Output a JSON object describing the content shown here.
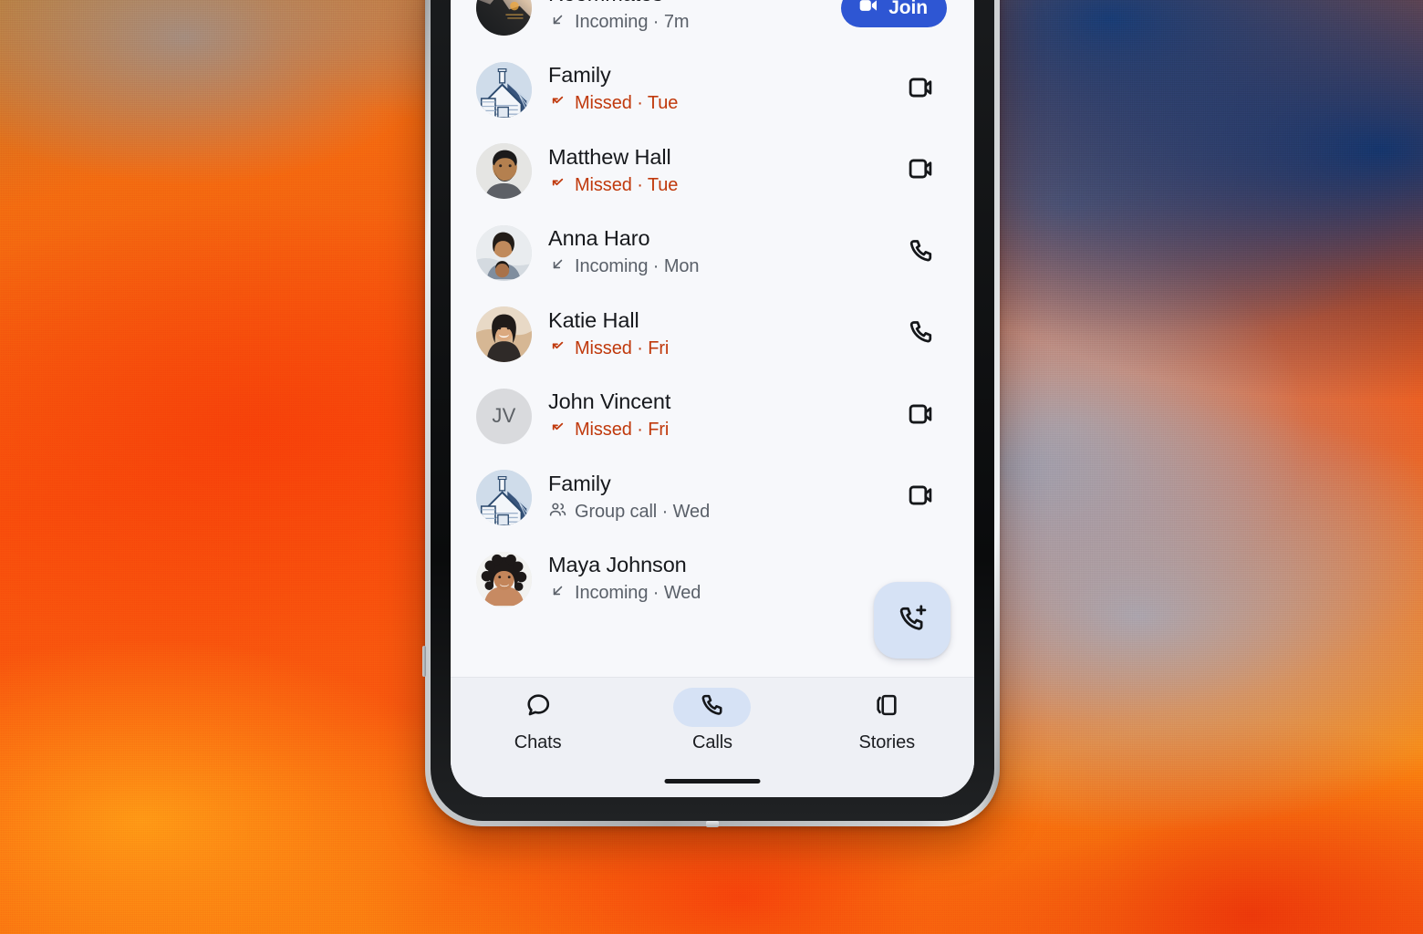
{
  "background": {
    "description": "orange to blue gradient wallpaper",
    "colors": {
      "orange": "#f8500c",
      "amber": "#fb8a10",
      "blue": "#103a78",
      "gray": "#969eb2"
    }
  },
  "device": {
    "frame_color": "#c9ccce",
    "screen_bg": "#f7f8fb"
  },
  "colors": {
    "accent_blue": "#2e56d3",
    "missed_red": "#c0390c",
    "pill_blue": "#d6e2f5",
    "nav_bg": "#eef0f5",
    "text_primary": "#16181c",
    "text_secondary": "#5a6069"
  },
  "call_list": {
    "rows": [
      {
        "name": "Roommates",
        "status": "Incoming · 7m",
        "status_type": "incoming",
        "status_icon": "arrow-down-left-icon",
        "avatar": "photo-sunset",
        "action": "join",
        "action_label": "Join",
        "action_icon": "video-camera-icon"
      },
      {
        "name": "Family",
        "status": "Missed · Tue",
        "status_type": "missed",
        "status_icon": "missed-call-arrow-icon",
        "avatar": "illustration-house",
        "action": "video",
        "action_icon": "video-camera-icon"
      },
      {
        "name": "Matthew Hall",
        "status": "Missed · Tue",
        "status_type": "missed",
        "status_icon": "missed-call-arrow-icon",
        "avatar": "photo-man-beard",
        "action": "video",
        "action_icon": "video-camera-icon"
      },
      {
        "name": "Anna Haro",
        "status": "Incoming · Mon",
        "status_type": "incoming",
        "status_icon": "arrow-down-left-icon",
        "avatar": "photo-woman-child",
        "action": "audio",
        "action_icon": "phone-icon"
      },
      {
        "name": "Katie Hall",
        "status": "Missed · Fri",
        "status_type": "missed",
        "status_icon": "missed-call-arrow-icon",
        "avatar": "photo-woman-smiling",
        "action": "audio",
        "action_icon": "phone-icon"
      },
      {
        "name": "John Vincent",
        "status": "Missed · Fri",
        "status_type": "missed",
        "status_icon": "missed-call-arrow-icon",
        "avatar": "initials",
        "avatar_initials": "JV",
        "action": "video",
        "action_icon": "video-camera-icon"
      },
      {
        "name": "Family",
        "status": "Group call · Wed",
        "status_type": "group",
        "status_icon": "people-icon",
        "avatar": "illustration-house",
        "action": "video",
        "action_icon": "video-camera-icon"
      },
      {
        "name": "Maya Johnson",
        "status": "Incoming · Wed",
        "status_type": "incoming",
        "status_icon": "arrow-down-left-icon",
        "avatar": "photo-woman-curly",
        "action": "none"
      }
    ]
  },
  "fab": {
    "icon": "phone-add-icon",
    "label": "New call"
  },
  "bottom_nav": {
    "items": [
      {
        "label": "Chats",
        "icon": "chat-bubble-icon",
        "active": false
      },
      {
        "label": "Calls",
        "icon": "phone-icon",
        "active": true
      },
      {
        "label": "Stories",
        "icon": "stories-icon",
        "active": false
      }
    ]
  }
}
